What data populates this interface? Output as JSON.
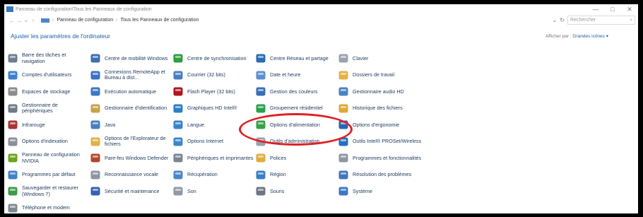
{
  "window": {
    "title": "Panneau de configuration\\Tous les Panneaux de configuration",
    "controls": [
      "—",
      "□",
      "✕"
    ]
  },
  "address": {
    "crumbs": [
      "Panneau de configuration",
      "Tous les Panneaux de configuration"
    ],
    "separator": "›",
    "search_placeholder": "Rechercher"
  },
  "header": {
    "heading": "Ajuster les paramètres de l'ordinateur",
    "view_by_label": "Afficher par :",
    "view_by_value": "Grandes icônes ▾"
  },
  "items": [
    {
      "label": "Barre des tâches et navigation",
      "icon": "taskbar-icon",
      "color": "#6b7d92"
    },
    {
      "label": "Centre de mobilité Windows",
      "icon": "mobility-icon",
      "color": "#3b6fb0"
    },
    {
      "label": "Centre de synchronisation",
      "icon": "sync-icon",
      "color": "#2f9e3b"
    },
    {
      "label": "Centre Réseau et partage",
      "icon": "network-icon",
      "color": "#2a6bb6"
    },
    {
      "label": "Clavier",
      "icon": "keyboard-icon",
      "color": "#9aa3ad"
    },
    {
      "label": "Comptes d'utilisateurs",
      "icon": "users-icon",
      "color": "#3f7fcf"
    },
    {
      "label": "Connexions RemoteApp et Bureau à dist...",
      "icon": "remoteapp-icon",
      "color": "#3b73c0"
    },
    {
      "label": "Courrier (32 bits)",
      "icon": "mail-icon",
      "color": "#4a7ec2"
    },
    {
      "label": "Date et heure",
      "icon": "clock-icon",
      "color": "#5b8fd0"
    },
    {
      "label": "Dossiers de travail",
      "icon": "folder-icon",
      "color": "#e4b144"
    },
    {
      "label": "Espaces de stockage",
      "icon": "storage-icon",
      "color": "#8c8c8c"
    },
    {
      "label": "Exécution automatique",
      "icon": "autoplay-icon",
      "color": "#3f77c2"
    },
    {
      "label": "Flash Player (32 bits)",
      "icon": "flash-icon",
      "color": "#b0161b"
    },
    {
      "label": "Gestion des couleurs",
      "icon": "color-icon",
      "color": "#3a6db8"
    },
    {
      "label": "Gestionnaire audio HD",
      "icon": "audio-icon",
      "color": "#4a82c6"
    },
    {
      "label": "Gestionnaire de périphériques",
      "icon": "devices-icon",
      "color": "#6d7a87"
    },
    {
      "label": "Gestionnaire d'identification",
      "icon": "credential-icon",
      "color": "#c7a24a"
    },
    {
      "label": "Graphiques HD Intel®",
      "icon": "intel-graphics-icon",
      "color": "#2c7fc8"
    },
    {
      "label": "Groupement résidentiel",
      "icon": "homegroup-icon",
      "color": "#2aa14b"
    },
    {
      "label": "Historique des fichiers",
      "icon": "filehistory-icon",
      "color": "#e0a83a"
    },
    {
      "label": "Infrarouge",
      "icon": "infrared-icon",
      "color": "#a33"
    },
    {
      "label": "Java",
      "icon": "java-icon",
      "color": "#4a7fbf"
    },
    {
      "label": "Langue",
      "icon": "language-icon",
      "color": "#3a83c9"
    },
    {
      "label": "Options d'alimentation",
      "icon": "power-icon",
      "color": "#3aa046"
    },
    {
      "label": "Options d'ergonomie",
      "icon": "ease-icon",
      "color": "#2a65b5"
    },
    {
      "label": "Options d'indexation",
      "icon": "indexing-icon",
      "color": "#8a8f99"
    },
    {
      "label": "Options de l'Explorateur de fichiers",
      "icon": "explorer-options-icon",
      "color": "#e1b046"
    },
    {
      "label": "Options Internet",
      "icon": "internet-icon",
      "color": "#3b86c8"
    },
    {
      "label": "Outils d'administration",
      "icon": "admin-tools-icon",
      "color": "#9aa0a8"
    },
    {
      "label": "Outils Intel® PROSet/Wireless",
      "icon": "intel-wireless-icon",
      "color": "#1f6fc4"
    },
    {
      "label": "Panneau de configuration NVIDIA",
      "icon": "nvidia-icon",
      "color": "#6aa51e"
    },
    {
      "label": "Pare-feu Windows Defender",
      "icon": "firewall-icon",
      "color": "#b2472a"
    },
    {
      "label": "Périphériques et imprimantes",
      "icon": "printer-icon",
      "color": "#7b8590"
    },
    {
      "label": "Polices",
      "icon": "fonts-icon",
      "color": "#e0ad3e"
    },
    {
      "label": "Programmes et fonctionnalités",
      "icon": "programs-icon",
      "color": "#8d96a2"
    },
    {
      "label": "Programmes par défaut",
      "icon": "default-programs-icon",
      "color": "#3e82c8"
    },
    {
      "label": "Reconnaissance vocale",
      "icon": "microphone-icon",
      "color": "#8d96a2"
    },
    {
      "label": "Récupération",
      "icon": "recovery-icon",
      "color": "#4a86c8"
    },
    {
      "label": "Région",
      "icon": "region-icon",
      "color": "#3b7fc4"
    },
    {
      "label": "Résolution des problèmes",
      "icon": "troubleshoot-icon",
      "color": "#3e77be"
    },
    {
      "label": "Sauvegarder et restaurer (Windows 7)",
      "icon": "backup-icon",
      "color": "#3d9b48"
    },
    {
      "label": "Sécurité et maintenance",
      "icon": "flag-icon",
      "color": "#3163b3"
    },
    {
      "label": "Son",
      "icon": "speaker-icon",
      "color": "#8f9aa5"
    },
    {
      "label": "Souris",
      "icon": "mouse-icon",
      "color": "#6e7781"
    },
    {
      "label": "Système",
      "icon": "system-icon",
      "color": "#3d77c2"
    },
    {
      "label": "Téléphone et modem",
      "icon": "phone-modem-icon",
      "color": "#7f8892"
    }
  ],
  "highlight": {
    "target_label": "Options d'alimentation",
    "color": "#e01f24"
  }
}
